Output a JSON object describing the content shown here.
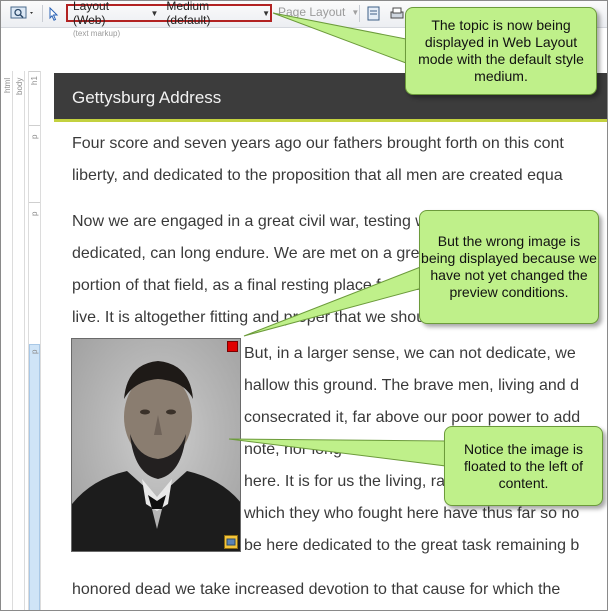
{
  "toolbar": {
    "layout_dropdown": "Layout (Web)",
    "medium_dropdown": "Medium (default)",
    "page_layout_dropdown": "Page Layout",
    "text_markup_hint": "(text markup)"
  },
  "structure_bar": {
    "labels": [
      "html",
      "body",
      "h1",
      "p",
      "p",
      "p"
    ]
  },
  "document": {
    "heading": "Gettysburg Address",
    "lines": [
      "Four score and seven years ago our fathers brought forth on this cont",
      "liberty, and dedicated to the proposition that all men are created equa",
      "Now we are engaged in a great civil war, testing whether that nation, or",
      "dedicated, can long endure. We are met on a great battle-field of that w",
      "portion of that field, as a final resting place for those who here gave th",
      "live. It is altogether fitting and proper that we should do this.",
      "But, in a larger sense, we can not dedicate, we",
      "hallow this ground. The brave men, living and d",
      "consecrated it, far above our poor power to add",
      "note, nor long remember what we say here, but",
      "here. It is for us the living, rather, to be dedicat",
      "which they who fought here have thus far so no",
      "be here dedicated to the great task remaining b",
      "honored dead we take increased devotion to that cause for which the"
    ]
  },
  "callouts": {
    "top": "The topic is now being displayed in Web Layout mode with the default style medium.",
    "middle": "But the wrong image is being displayed because we have not yet changed the preview conditions.",
    "bottom": "Notice the image is floated to the left of content."
  },
  "colors": {
    "heading_bar": "#3c3c3c",
    "heading_rule": "#c3d13f",
    "callout_fill": "#bff08a",
    "highlight_border": "#b22222"
  }
}
